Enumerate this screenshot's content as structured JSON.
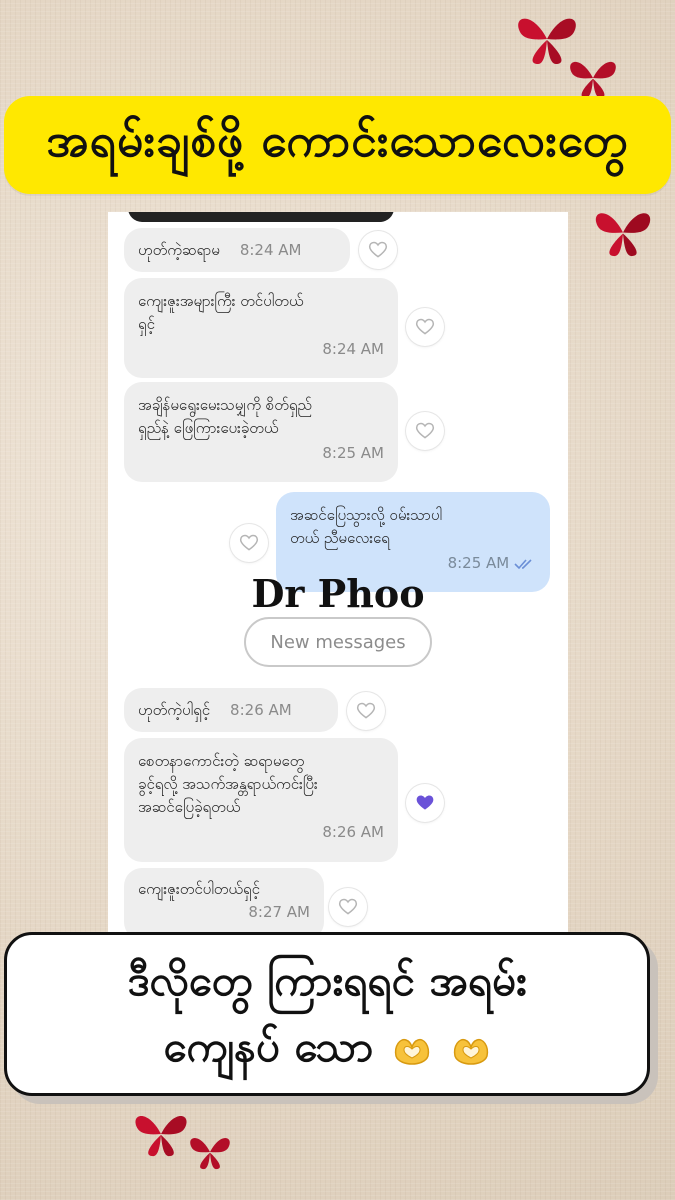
{
  "banner": {
    "title": "အရမ်းချစ်ဖို့ ကောင်းသောလေးတွေ"
  },
  "chat": {
    "messages": [
      {
        "direction": "in",
        "text": "ဟုတ်ကဲ့ဆရာမ",
        "time": "8:24 AM"
      },
      {
        "direction": "in",
        "text_lines": [
          "ကျေးဇူးအများကြီး တင်ပါတယ်",
          "ရှင့်"
        ],
        "time": "8:24 AM"
      },
      {
        "direction": "in",
        "text_lines": [
          "အချိန်မရွေးမေးသမျှကို စိတ်ရှည်",
          "ရှည်နဲ့ ဖြေကြားပေးခဲ့တယ်"
        ],
        "time": "8:25 AM"
      },
      {
        "direction": "out",
        "text_lines": [
          "အဆင်ပြေသွားလို့ ဝမ်းသာပါ",
          "တယ် ညီမလေးရေ"
        ],
        "time": "8:25 AM",
        "status": "read-double-check"
      },
      {
        "direction": "in",
        "text": "ဟုတ်ကဲ့ပါရှင့်",
        "time": "8:26 AM"
      },
      {
        "direction": "in",
        "text_lines": [
          "စေတနာကောင်းတဲ့ ဆရာမတွေ",
          "ခွင့်ရလို့ အသက်အန္တရာယ်ကင်းပြီး",
          "အဆင်ပြေခဲ့ရတယ်"
        ],
        "time": "8:26 AM",
        "reacted": true
      },
      {
        "direction": "in",
        "text": "ကျေးဇူးတင်ပါတယ်ရှင့်",
        "time": "8:27 AM"
      }
    ],
    "new_messages_label": "New messages",
    "watermark": "Dr Phoo",
    "colors": {
      "incoming": "#eeeeee",
      "outgoing": "#cfe3fb",
      "reaction": "#6a52d8"
    }
  },
  "caption": {
    "line1": "ဒီလိုတွေ ကြားရရင် အရမ်း",
    "line2": "ကျေနပ် သော",
    "emoji": "heart-hands-icon"
  },
  "decor": {
    "icon": "red-butterfly-icon",
    "accent": "#c8102e"
  }
}
